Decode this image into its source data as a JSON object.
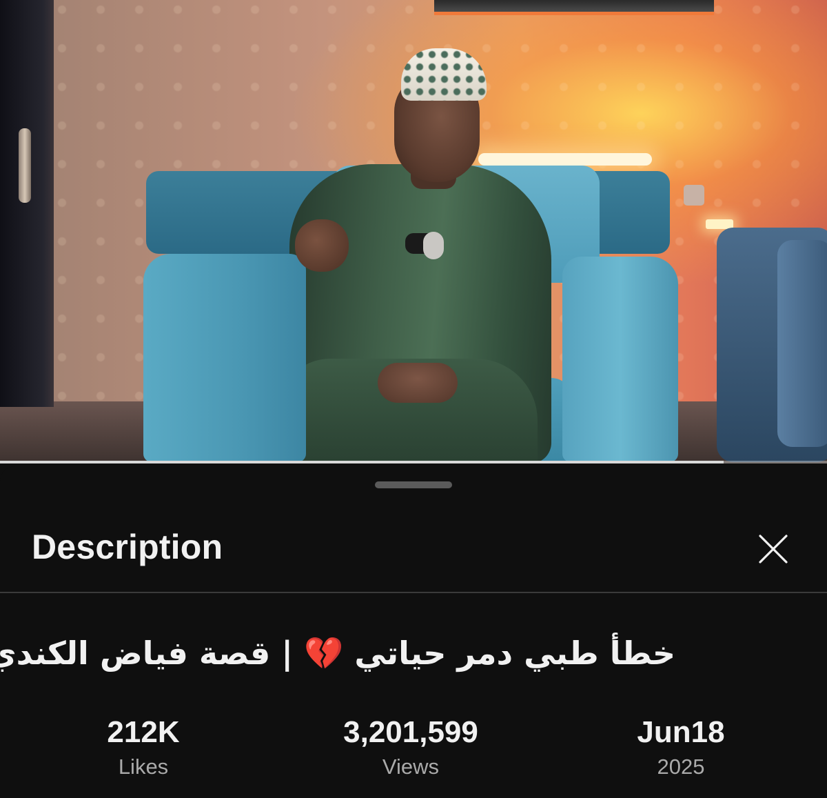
{
  "video": {
    "progress_fraction": 0.875
  },
  "description_sheet": {
    "title": "Description",
    "close_icon": "close-icon",
    "video_title": "خطأ طبي دمر حياتي 💔 | قصة فياض الكندي",
    "stats": {
      "likes": {
        "value": "212K",
        "label": "Likes"
      },
      "views": {
        "value": "3,201,599",
        "label": "Views"
      },
      "date": {
        "value": "Jun18",
        "label": "2025"
      }
    }
  },
  "colors": {
    "sheet_background": "#0f0f0f",
    "primary_text": "#f1f1f1",
    "secondary_text": "#aaaaaa",
    "divider": "#3a3a3a"
  }
}
